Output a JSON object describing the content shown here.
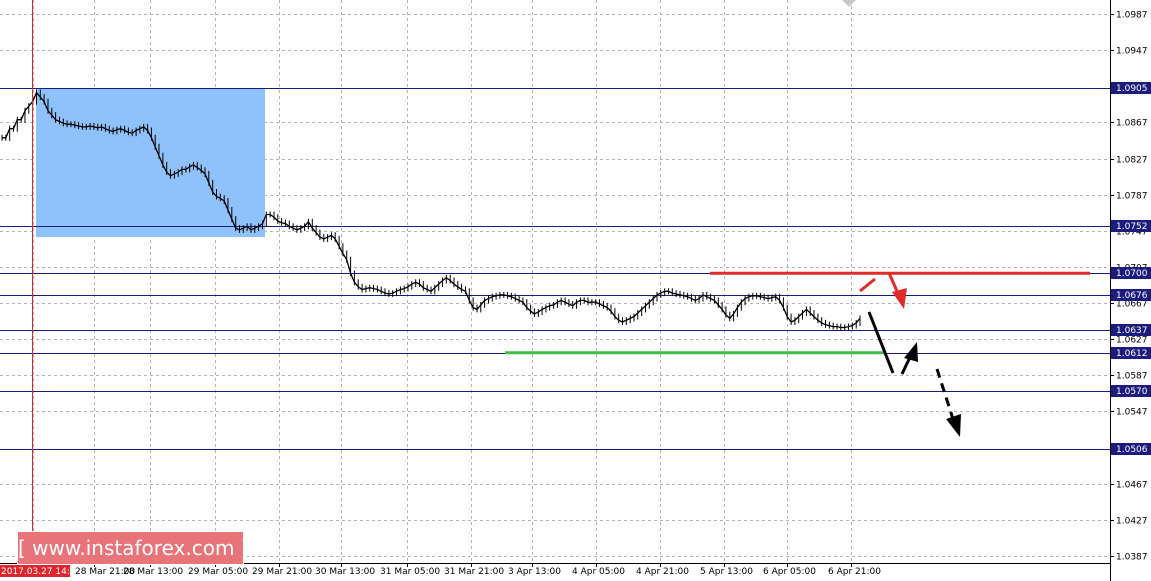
{
  "chart_data": {
    "type": "candlestick",
    "y_range": [
      1.0377,
      1.1007
    ],
    "y_ticks": [
      "1.0987",
      "1.0947",
      "1.0867",
      "1.0827",
      "1.0787",
      "1.0747",
      "1.0707",
      "1.0667",
      "1.0627",
      "1.0587",
      "1.0547",
      "1.0467",
      "1.0427",
      "1.0387"
    ],
    "x_ticks": [
      "2017.03.27 14:00",
      "28 Mar 21:00",
      "28 Mar 13:00",
      "29 Mar 05:00",
      "29 Mar 21:00",
      "30 Mar 13:00",
      "31 Mar 05:00",
      "31 Mar 21:00",
      "3 Apr 13:00",
      "4 Apr 05:00",
      "4 Apr 21:00",
      "5 Apr 13:00",
      "6 Apr 05:00",
      "6 Apr 21:00"
    ],
    "levels": [
      "1.0905",
      "1.0752",
      "1.0700",
      "1.0676",
      "1.0637",
      "1.0612",
      "1.0570",
      "1.0506"
    ],
    "highlight_zone": {
      "from": 1.0905,
      "to": 1.074
    },
    "resistance": 1.07,
    "support": 1.0612,
    "series": [
      {
        "values": [
          1.085,
          1.085,
          1.086,
          1.086,
          1.087,
          1.087,
          1.088,
          1.0885,
          1.089,
          1.09,
          1.0895,
          1.089,
          1.088,
          1.0875,
          1.087,
          1.0868,
          1.0866,
          1.0865,
          1.0865,
          1.0864,
          1.0863,
          1.0862,
          1.0862,
          1.0863,
          1.0862,
          1.0861,
          1.0862,
          1.086,
          1.0858,
          1.0857,
          1.0859,
          1.086,
          1.0858,
          1.0856,
          1.0855,
          1.0858,
          1.086,
          1.0862,
          1.0858,
          1.085,
          1.084,
          1.083,
          1.082,
          1.0812,
          1.0808,
          1.081,
          1.0812,
          1.0815,
          1.0815,
          1.0818,
          1.082,
          1.0817,
          1.0814,
          1.081,
          1.08,
          1.079,
          1.0785,
          1.0783,
          1.078,
          1.077,
          1.076,
          1.075,
          1.0748,
          1.075,
          1.0752,
          1.0748,
          1.075,
          1.0752,
          1.0755,
          1.0765,
          1.0765,
          1.0762,
          1.0758,
          1.0756,
          1.0755,
          1.0752,
          1.075,
          1.0748,
          1.075,
          1.0752,
          1.0757,
          1.075,
          1.0745,
          1.074,
          1.0738,
          1.074,
          1.0742,
          1.0738,
          1.073,
          1.0722,
          1.0715,
          1.07,
          1.069,
          1.0685,
          1.0682,
          1.0683,
          1.0684,
          1.0683,
          1.0682,
          1.068,
          1.0678,
          1.0677,
          1.0678,
          1.068,
          1.0682,
          1.0683,
          1.0685,
          1.0688,
          1.069,
          1.0688,
          1.0684,
          1.0682,
          1.068,
          1.0684,
          1.0688,
          1.0692,
          1.0695,
          1.0692,
          1.0688,
          1.0685,
          1.0682,
          1.068,
          1.067,
          1.0662,
          1.066,
          1.0665,
          1.067,
          1.0672,
          1.0674,
          1.0675,
          1.0676,
          1.0676,
          1.0675,
          1.0674,
          1.0672,
          1.067,
          1.0668,
          1.0662,
          1.0658,
          1.0655,
          1.0657,
          1.066,
          1.0662,
          1.0664,
          1.0665,
          1.0668,
          1.067,
          1.0668,
          1.0666,
          1.0664,
          1.0668,
          1.067,
          1.067,
          1.0668,
          1.0668,
          1.0668,
          1.0666,
          1.0664,
          1.0662,
          1.0658,
          1.0652,
          1.0648,
          1.0646,
          1.0648,
          1.065,
          1.0652,
          1.0656,
          1.066,
          1.0664,
          1.0668,
          1.0672,
          1.0676,
          1.0678,
          1.068,
          1.068,
          1.0678,
          1.0677,
          1.0676,
          1.0675,
          1.0674,
          1.0672,
          1.067,
          1.0672,
          1.0676,
          1.0674,
          1.0672,
          1.067,
          1.0665,
          1.066,
          1.0654,
          1.065,
          1.0655,
          1.0662,
          1.0668,
          1.0672,
          1.0674,
          1.0675,
          1.0675,
          1.0674,
          1.0673,
          1.0672,
          1.0673,
          1.0674,
          1.067,
          1.0662,
          1.0652,
          1.0646,
          1.0648,
          1.0652,
          1.0656,
          1.066,
          1.0656,
          1.0652,
          1.0648,
          1.0645,
          1.0643,
          1.0642,
          1.0641,
          1.0641,
          1.064,
          1.064,
          1.0641,
          1.0642,
          1.0645,
          1.065
        ]
      }
    ]
  },
  "watermark": {
    "text": "[ www.instaforex.com ]"
  },
  "colors": {
    "zone": "#8fc1fb",
    "level_line": "#1c1c7c",
    "grid": "#b4b4b4",
    "resistance": "#e12a2a",
    "support": "#3fbf4a",
    "marker": "#e0242d",
    "watermark_bg": "#e8747a"
  }
}
